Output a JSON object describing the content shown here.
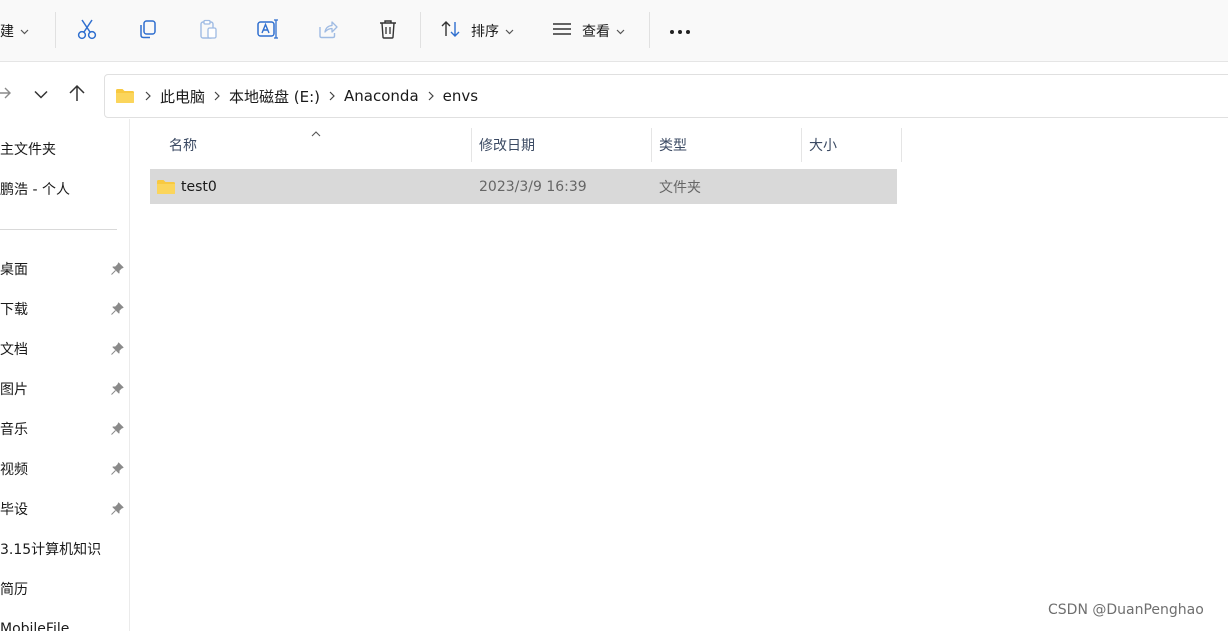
{
  "toolbar": {
    "new_label": "新建",
    "sort_label": "排序",
    "view_label": "查看",
    "more_label": "•••"
  },
  "address": {
    "crumbs": [
      "此电脑",
      "本地磁盘 (E:)",
      "Anaconda",
      "envs"
    ]
  },
  "sidebar": {
    "quick": [
      "主文件夹",
      "鹏浩 - 个人"
    ],
    "pinned": [
      "桌面",
      "下载",
      "文档",
      "图片",
      "音乐",
      "视频",
      "毕设"
    ],
    "other": [
      "3.15计算机知识",
      "简历",
      "MobileFile"
    ]
  },
  "columns": {
    "name": "名称",
    "modified": "修改日期",
    "type": "类型",
    "size": "大小"
  },
  "files": [
    {
      "name": "test0",
      "modified": "2023/3/9 16:39",
      "type": "文件夹",
      "size": ""
    }
  ],
  "watermark": "CSDN @DuanPenghao",
  "colors": {
    "folder": "#f8c940",
    "selected_row": "#d9d9d9",
    "accent_icon": "#2f6fcf"
  }
}
